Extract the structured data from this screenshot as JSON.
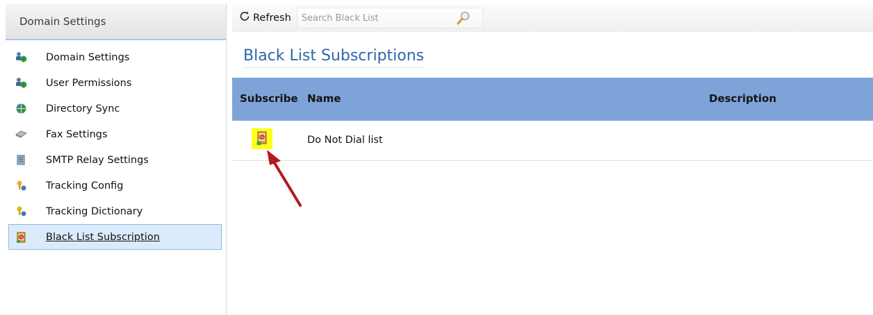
{
  "sidebar": {
    "header": "Domain Settings",
    "items": [
      {
        "label": "Domain Settings",
        "icon": "users-globe-icon"
      },
      {
        "label": "User Permissions",
        "icon": "users-globe-icon"
      },
      {
        "label": "Directory Sync",
        "icon": "sync-globe-icon"
      },
      {
        "label": "Fax Settings",
        "icon": "fax-icon"
      },
      {
        "label": "SMTP Relay Settings",
        "icon": "server-icon"
      },
      {
        "label": "Tracking Config",
        "icon": "key-user-icon"
      },
      {
        "label": "Tracking Dictionary",
        "icon": "key-user-icon"
      },
      {
        "label": "Black List Subscription",
        "icon": "blacklist-book-icon",
        "active": true
      }
    ]
  },
  "toolbar": {
    "refresh_label": "Refresh",
    "search_placeholder": "Search Black List"
  },
  "main": {
    "title": "Black List Subscriptions",
    "columns": [
      "Subscribe",
      "Name",
      "Description"
    ],
    "rows": [
      {
        "subscribe_icon": "blacklist-book-icon",
        "subscribe_highlighted": true,
        "name": "Do Not Dial list",
        "description": ""
      }
    ]
  },
  "colors": {
    "accent": "#2e66ad",
    "grid_header": "#7ea3d8",
    "selected_item": "#dcebfb",
    "highlight": "#ffff1a",
    "annotation_arrow": "#b3191c"
  }
}
